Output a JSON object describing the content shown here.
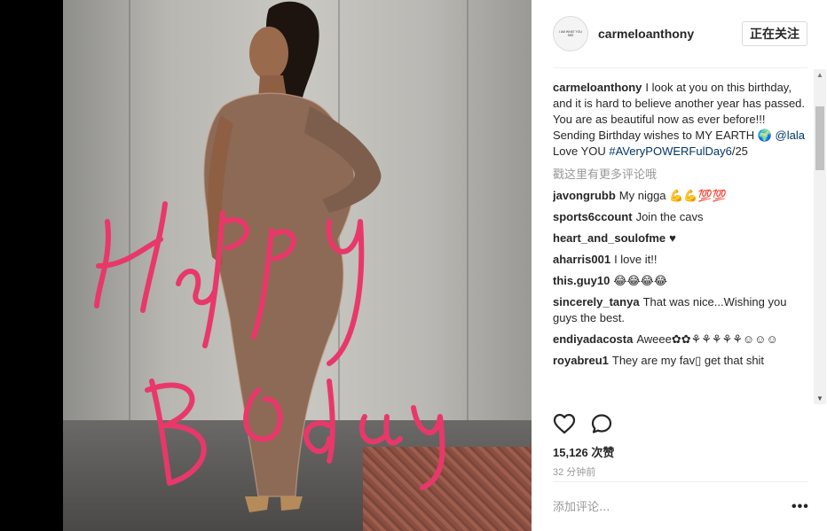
{
  "post": {
    "username": "carmeloanthony",
    "follow_label": "正在关注",
    "avatar_text": "I AM WHAT YOU SEE",
    "caption": {
      "username": "carmeloanthony",
      "text_1": "I look at you on this birthday, and it is hard to believe another year has passed. You are as beautiful now as ever before!!! Sending Birthday wishes to MY EARTH 🌍 ",
      "mention": "@lala",
      "text_2": " Love YOU ",
      "hashtag": "#AVeryPOWERFulDay6",
      "text_3": "/25"
    },
    "more_comments_label": "戳这里有更多评论哦",
    "comments": [
      {
        "user": "javongrubb",
        "text": "My nigga 💪💪💯💯"
      },
      {
        "user": "sports6ccount",
        "text": "Join the cavs"
      },
      {
        "user": "heart_and_soulofme",
        "text": "♥"
      },
      {
        "user": "aharris001",
        "text": "I love it!!"
      },
      {
        "user": "this.guy10",
        "text": "😂😂😂😂"
      },
      {
        "user": "sincerely_tanya",
        "text": "That was nice...Wishing you guys the best."
      },
      {
        "user": "endiyadacosta",
        "text": "Aweee✿✿⚘⚘⚘⚘⚘☺☺☺"
      },
      {
        "user": "royabreu1",
        "text": "They are my fav▯ get that shit"
      }
    ],
    "likes": "15,126 次赞",
    "time_ago": "32 分钟前",
    "add_comment_placeholder": "添加评论...",
    "more_options": "•••"
  },
  "photo": {
    "overlay_text": "Happy Bday",
    "overlay_color": "#e8386a"
  },
  "icons": {
    "like": "heart-icon",
    "comment": "comment-icon"
  }
}
